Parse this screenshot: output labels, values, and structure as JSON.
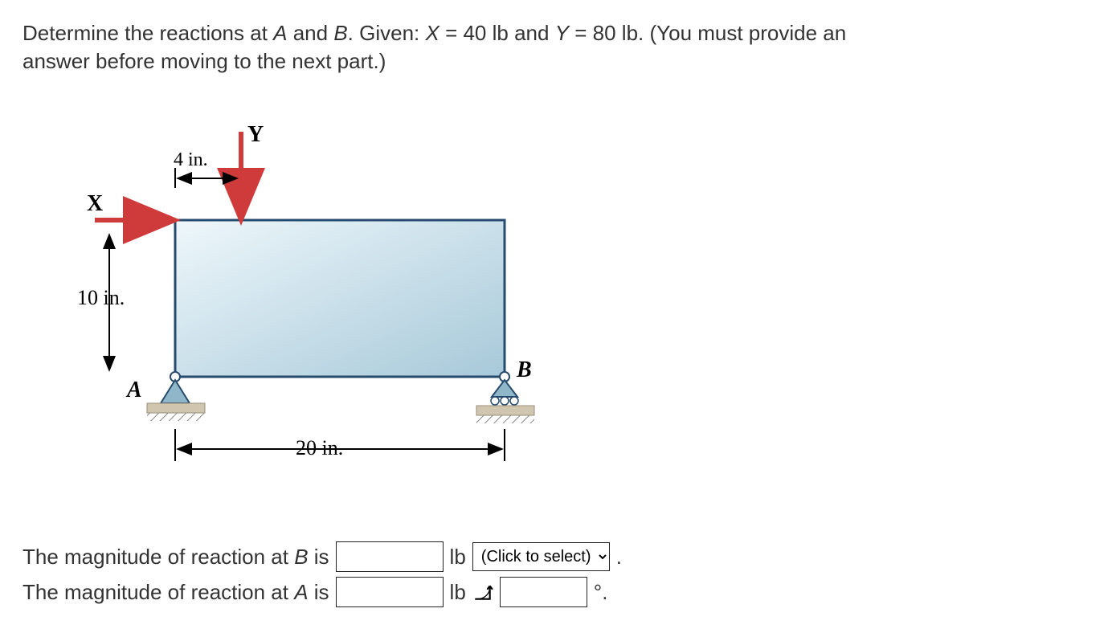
{
  "problem": {
    "prefix": "Determine the reactions at ",
    "A": "A",
    "and": " and ",
    "B": "B",
    "given": ". Given: ",
    "Xvar": "X",
    "Xval": " = 40 lb  and ",
    "Yvar": "Y",
    "Yval": " = 80 lb. (You must provide an answer before moving to the next part.)"
  },
  "figure": {
    "label_Y": "Y",
    "label_X": "X",
    "dim_4in": "4 in.",
    "dim_10in": "10 in.",
    "dim_20in": "20 in.",
    "label_A": "A",
    "label_B": "B"
  },
  "answers": {
    "lineB_pre": "The magnitude of reaction at ",
    "lineB_var": "B",
    "lineB_post": " is",
    "unit_lb": "lb",
    "select_placeholder": "(Click to select)",
    "period": ".",
    "lineA_pre": "The magnitude of reaction at ",
    "lineA_var": "A",
    "lineA_post": " is",
    "deg_suffix": "°."
  }
}
